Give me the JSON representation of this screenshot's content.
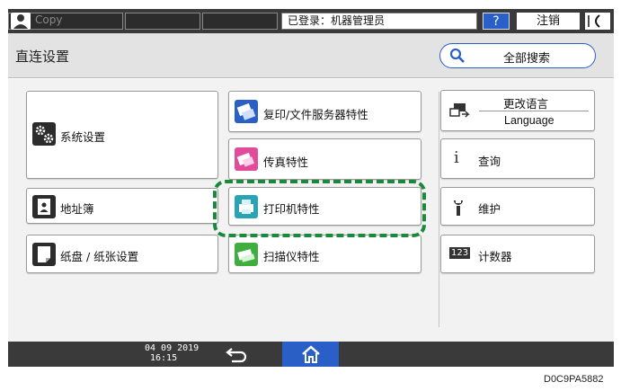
{
  "topbar": {
    "copy_label": "Copy",
    "login_text": "已登录：机器管理员",
    "help_label": "?",
    "logout_label": "注销",
    "energy_symbol": "("
  },
  "header": {
    "title": "直连设置",
    "search_all_label": "全部搜索"
  },
  "main": {
    "left_buttons": [
      {
        "label": "系统设置",
        "icon": "gears-icon"
      },
      {
        "label": "地址簿",
        "icon": "address-book-icon"
      },
      {
        "label": "纸盘 / 纸张设置",
        "icon": "paper-tray-icon"
      }
    ],
    "middle_buttons": [
      {
        "label": "复印/文件服务器特性",
        "icon": "copier-icon"
      },
      {
        "label": "传真特性",
        "icon": "fax-icon"
      },
      {
        "label": "打印机特性",
        "icon": "printer-icon"
      },
      {
        "label": "扫描仪特性",
        "icon": "scanner-icon"
      }
    ],
    "right_buttons": {
      "language_top": "更改语言",
      "language_bottom": "Language",
      "inquiry": "查询",
      "maintenance": "维护",
      "counter": "计数器",
      "counter_icon_text": "123"
    }
  },
  "bottombar": {
    "date": "04 09 2019",
    "time": "16:15"
  },
  "caption": "D0C9PA5882",
  "colors": {
    "accent": "#2a5fc8",
    "highlight": "#1a8a3a",
    "bar": "#3a3a3a"
  }
}
